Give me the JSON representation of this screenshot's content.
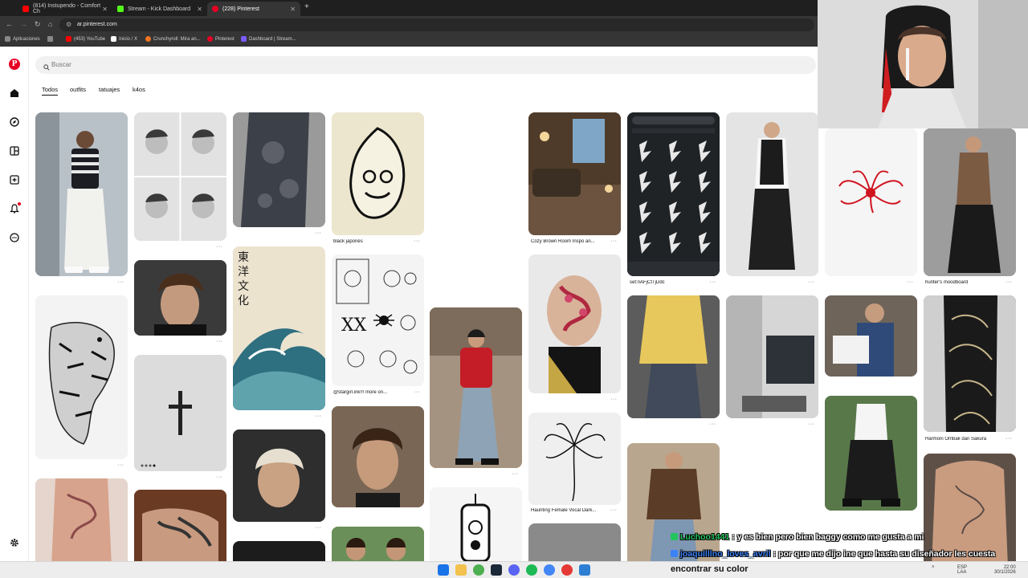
{
  "browser": {
    "tabs": [
      {
        "title": "(814) Instupendo - Comfort Ch",
        "color": "#ff0000"
      },
      {
        "title": "Stream - Kick Dashboard",
        "color": "#53fc18"
      },
      {
        "title": "(228) Pinterest",
        "color": "#e60023"
      }
    ],
    "url": "ar.pinterest.com",
    "bookmarks": [
      {
        "label": "Aplicaciones",
        "color": "#888888"
      },
      {
        "label": "(453) YouTube",
        "color": "#ff0000"
      },
      {
        "label": "Inicio / X",
        "color": "#ffffff"
      },
      {
        "label": "Crunchyroll: Mira an...",
        "color": "#f47521"
      },
      {
        "label": "Pinterest",
        "color": "#e60023"
      },
      {
        "label": "Dashboard | Stream...",
        "color": "#7b5cff"
      }
    ]
  },
  "pinterest": {
    "logo": "P",
    "search_placeholder": "Buscar",
    "filters": [
      "Todos",
      "outfits",
      "tatuajes",
      "k4os"
    ],
    "rail_icons": [
      "home-icon",
      "explore-icon",
      "boards-icon",
      "create-icon",
      "notifications-icon",
      "messages-icon",
      "settings-icon"
    ],
    "captions": {
      "black_japones": "black japonés",
      "stargirl": "@stargirl.ink!!! more on...",
      "cozy_room": "Cozy Brown Room Inspo an...",
      "set_code": "set:nAFjCtTjDdc",
      "hunters_moodboard": "hunter's moodboard",
      "haunting": "Haunting Female Vocal Dark...",
      "harmoni": "Harmoni Ombak dan Sakura"
    },
    "kanji": "東洋文化"
  },
  "chat": [
    {
      "user": "Luchoo1441",
      "message": ": y es bien pero bien baggy como me gusta a mi"
    },
    {
      "user": "joaquilllno_loves_avril",
      "message": ": por que me dijo ine que hasta su diseñador les cuesta"
    }
  ],
  "caption": "encontrar su color",
  "taskbar": {
    "lang": "ESP",
    "region": "LAA",
    "time": "22:00",
    "date": "30/1/2026"
  }
}
